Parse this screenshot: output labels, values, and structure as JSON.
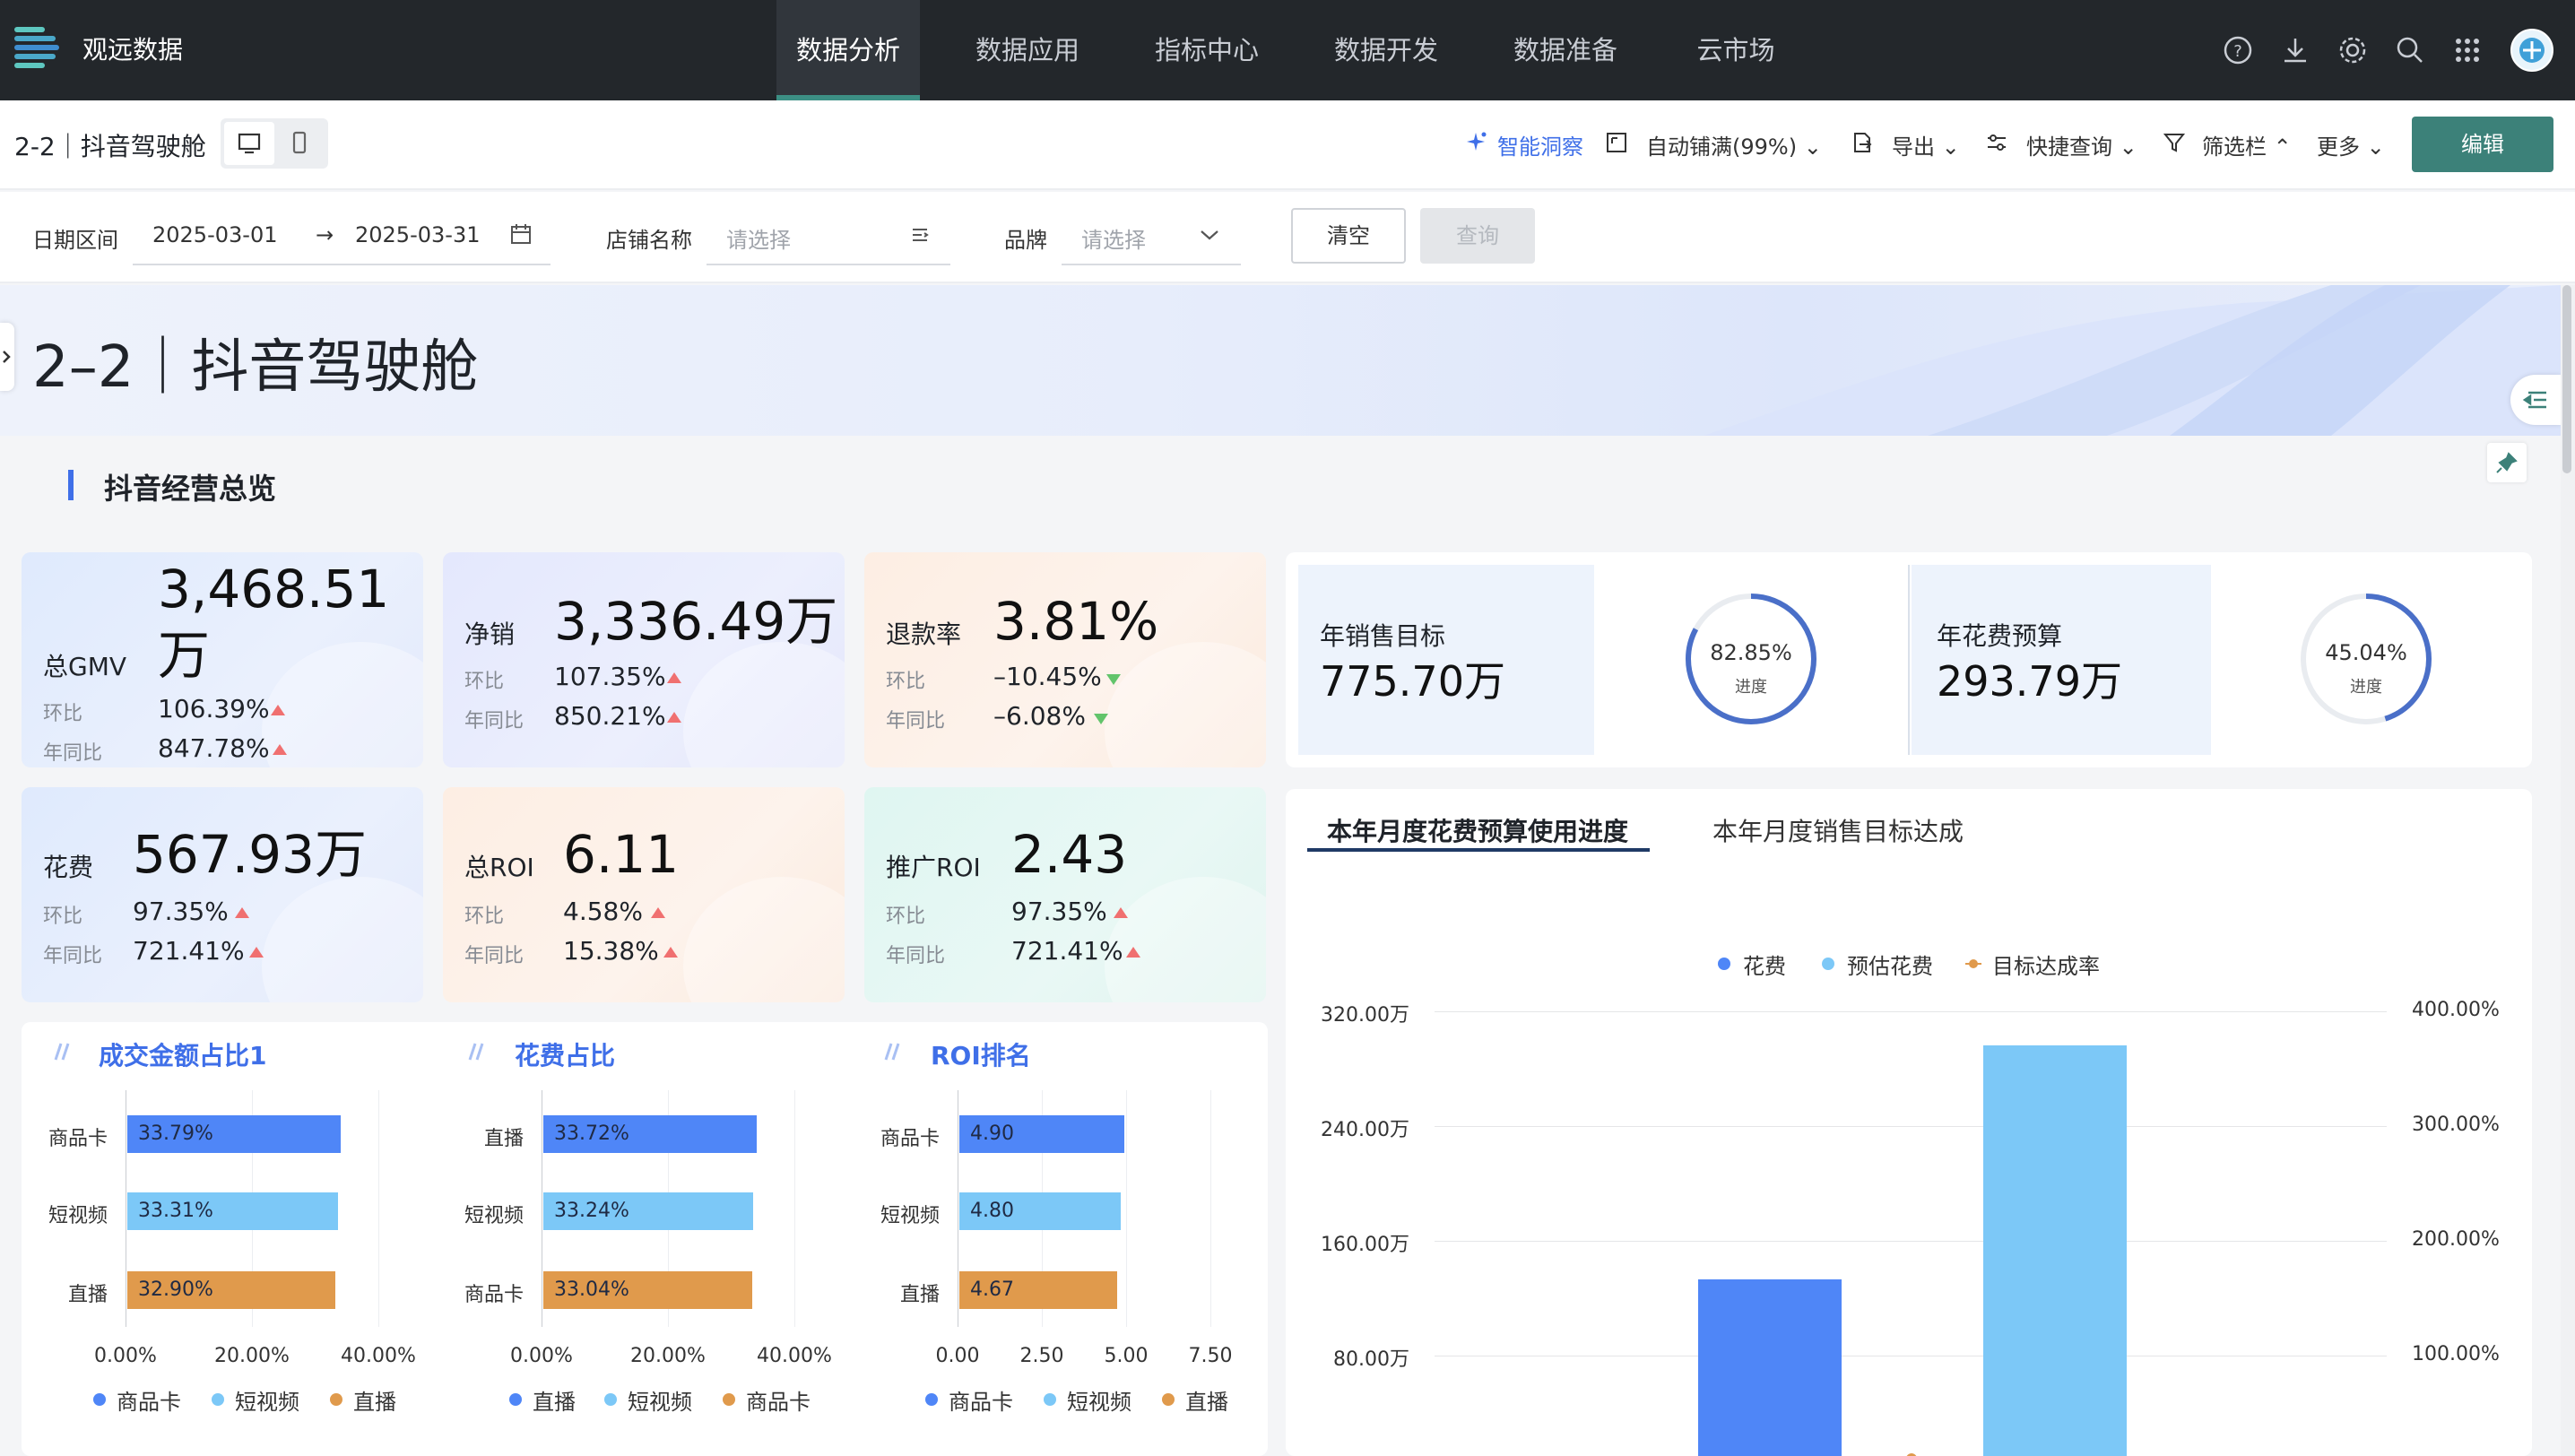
{
  "app": {
    "logo_text": "观远数据",
    "nav": [
      {
        "label": "数据分析",
        "active": true
      },
      {
        "label": "数据应用",
        "active": false
      },
      {
        "label": "指标中心",
        "active": false
      },
      {
        "label": "数据开发",
        "active": false
      },
      {
        "label": "数据准备",
        "active": false
      },
      {
        "label": "云市场",
        "active": false
      }
    ],
    "top_icons": [
      "help-icon",
      "download-icon",
      "settings-icon",
      "search-icon",
      "apps-grid-icon"
    ]
  },
  "toolbar": {
    "page_name": "2-2｜抖音驾驶舱",
    "smart_insight": "智能洞察",
    "auto_fill": "自动铺满(99%)",
    "export": "导出",
    "quick_query": "快捷查询",
    "filter_bar": "筛选栏",
    "more": "更多",
    "edit": "编辑"
  },
  "filters": {
    "date_label": "日期区间",
    "date_start": "2025-03-01",
    "date_arrow": "→",
    "date_end": "2025-03-31",
    "store_label": "店铺名称",
    "store_placeholder": "请选择",
    "brand_label": "品牌",
    "brand_placeholder": "请选择",
    "clear": "清空",
    "query": "查询"
  },
  "banner": {
    "title": "2–2｜抖音驾驶舱"
  },
  "section": {
    "title": "抖音经营总览"
  },
  "kpis": [
    {
      "label": "总GMV",
      "value_line1": "3,468.51",
      "value_line2": "万",
      "mom_label": "环比",
      "mom": "106.39%",
      "yoy_label": "年同比",
      "yoy": "847.78%"
    },
    {
      "label": "净销",
      "value": "3,336.49万",
      "mom_label": "环比",
      "mom": "107.35%",
      "yoy_label": "年同比",
      "yoy": "850.21%"
    },
    {
      "label": "退款率",
      "value": "3.81%",
      "mom_label": "环比",
      "mom": "–10.45%",
      "yoy_label": "年同比",
      "yoy": "–6.08%"
    },
    {
      "label": "花费",
      "value": "567.93万",
      "mom_label": "环比",
      "mom": "97.35%",
      "yoy_label": "年同比",
      "yoy": "721.41%"
    },
    {
      "label": "总ROI",
      "value": "6.11",
      "mom_label": "环比",
      "mom": "4.58%",
      "yoy_label": "年同比",
      "yoy": "15.38%"
    },
    {
      "label": "推广ROI",
      "value": "2.43",
      "mom_label": "环比",
      "mom": "97.35%",
      "yoy_label": "年同比",
      "yoy": "721.41%"
    }
  ],
  "targets": [
    {
      "label": "年销售目标",
      "value": "775.70万",
      "progress_text": "82.85%",
      "progress": 0.8285,
      "progress_label": "进度"
    },
    {
      "label": "年花费预算",
      "value": "293.79万",
      "progress_text": "45.04%",
      "progress": 0.4504,
      "progress_label": "进度"
    }
  ],
  "colors": {
    "blue": "#4f86f7",
    "light_blue": "#7cc8f7",
    "orange": "#e09a4c",
    "accent": "#3c8179"
  },
  "mini_charts": [
    {
      "title": "成交金额占比1",
      "categories": [
        "商品卡",
        "短视频",
        "直播"
      ],
      "values": [
        33.79,
        33.31,
        32.9
      ],
      "labels": [
        "33.79%",
        "33.31%",
        "32.90%"
      ],
      "xlim": [
        0,
        40
      ],
      "ticks": [
        "0.00%",
        "20.00%",
        "40.00%"
      ],
      "legend": [
        "商品卡",
        "短视频",
        "直播"
      ]
    },
    {
      "title": "花费占比",
      "categories": [
        "直播",
        "短视频",
        "商品卡"
      ],
      "values": [
        33.72,
        33.24,
        33.04
      ],
      "labels": [
        "33.72%",
        "33.24%",
        "33.04%"
      ],
      "xlim": [
        0,
        40
      ],
      "ticks": [
        "0.00%",
        "20.00%",
        "40.00%"
      ],
      "legend": [
        "直播",
        "短视频",
        "商品卡"
      ]
    },
    {
      "title": "ROI排名",
      "categories": [
        "商品卡",
        "短视频",
        "直播"
      ],
      "values": [
        4.9,
        4.8,
        4.67
      ],
      "labels": [
        "4.90",
        "4.80",
        "4.67"
      ],
      "xlim": [
        0,
        7.5
      ],
      "ticks": [
        "0.00",
        "2.50",
        "5.00",
        "7.50"
      ],
      "legend": [
        "商品卡",
        "短视频",
        "直播"
      ]
    }
  ],
  "right_chart": {
    "tabs": [
      {
        "label": "本年月度花费预算使用进度",
        "active": true
      },
      {
        "label": "本年月度销售目标达成",
        "active": false
      }
    ],
    "legend": [
      "花费",
      "预估花费",
      "目标达成率"
    ]
  },
  "chart_data": {
    "type": "bar",
    "title": "本年月度花费预算使用进度",
    "series": [
      {
        "name": "花费",
        "values": [
          133
        ]
      },
      {
        "name": "预估花费",
        "values": [
          296
        ]
      },
      {
        "name": "目标达成率",
        "values": [
          10
        ]
      }
    ],
    "y_left_ticks": [
      "320.00万",
      "240.00万",
      "160.00万",
      "80.00万"
    ],
    "y_right_ticks": [
      "400.00%",
      "300.00%",
      "200.00%",
      "100.00%"
    ],
    "ylim_left": [
      0,
      320
    ],
    "ylim_right": [
      0,
      400
    ],
    "grid": true,
    "legend_position": "top-center"
  }
}
